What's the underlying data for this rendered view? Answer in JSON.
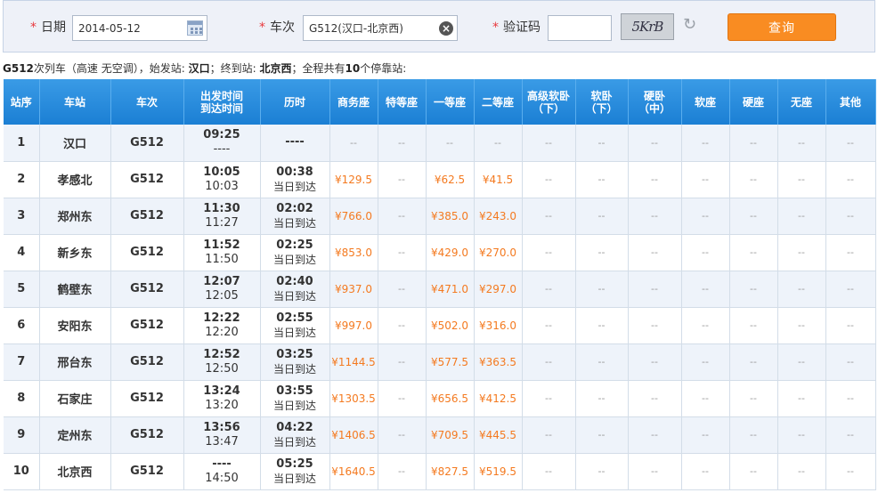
{
  "search": {
    "date_label": "日期",
    "date_value": "2014-05-12",
    "train_label": "车次",
    "train_value": "G512(汉口-北京西)",
    "captcha_label": "验证码",
    "captcha_value": "",
    "captcha_image_text": "5KrB",
    "query_button": "查询"
  },
  "summary": {
    "part1": "G512",
    "part2": "次列车（高速 无空调），始发站: ",
    "start": "汉口",
    "part3": "；终到站: ",
    "end": "北京西",
    "part4": "；全程共有",
    "count": "10",
    "part5": "个停靠站:"
  },
  "table": {
    "headers": {
      "seq": "站序",
      "station": "车站",
      "train": "车次",
      "time_top": "出发时间",
      "time_bottom": "到达时间",
      "duration": "历时",
      "business": "商务座",
      "special": "特等座",
      "first": "一等座",
      "second": "二等座",
      "soft_sleeper_top_1": "高级软卧",
      "soft_sleeper_top_2": "（下）",
      "soft_sleeper_1": "软卧",
      "soft_sleeper_2": "（下）",
      "hard_sleeper_1": "硬卧",
      "hard_sleeper_2": "（中）",
      "soft_seat": "软座",
      "hard_seat": "硬座",
      "no_seat": "无座",
      "other": "其他"
    },
    "rows": [
      {
        "seq": "1",
        "station": "汉口",
        "train": "G512",
        "dep": "09:25",
        "arr": "----",
        "dur": "----",
        "dur2": "",
        "business": "--",
        "first": "--",
        "second": "--"
      },
      {
        "seq": "2",
        "station": "孝感北",
        "train": "G512",
        "dep": "10:05",
        "arr": "10:03",
        "dur": "00:38",
        "dur2": "当日到达",
        "business": "¥129.5",
        "first": "¥62.5",
        "second": "¥41.5"
      },
      {
        "seq": "3",
        "station": "郑州东",
        "train": "G512",
        "dep": "11:30",
        "arr": "11:27",
        "dur": "02:02",
        "dur2": "当日到达",
        "business": "¥766.0",
        "first": "¥385.0",
        "second": "¥243.0"
      },
      {
        "seq": "4",
        "station": "新乡东",
        "train": "G512",
        "dep": "11:52",
        "arr": "11:50",
        "dur": "02:25",
        "dur2": "当日到达",
        "business": "¥853.0",
        "first": "¥429.0",
        "second": "¥270.0"
      },
      {
        "seq": "5",
        "station": "鹤壁东",
        "train": "G512",
        "dep": "12:07",
        "arr": "12:05",
        "dur": "02:40",
        "dur2": "当日到达",
        "business": "¥937.0",
        "first": "¥471.0",
        "second": "¥297.0"
      },
      {
        "seq": "6",
        "station": "安阳东",
        "train": "G512",
        "dep": "12:22",
        "arr": "12:20",
        "dur": "02:55",
        "dur2": "当日到达",
        "business": "¥997.0",
        "first": "¥502.0",
        "second": "¥316.0"
      },
      {
        "seq": "7",
        "station": "邢台东",
        "train": "G512",
        "dep": "12:52",
        "arr": "12:50",
        "dur": "03:25",
        "dur2": "当日到达",
        "business": "¥1144.5",
        "first": "¥577.5",
        "second": "¥363.5"
      },
      {
        "seq": "8",
        "station": "石家庄",
        "train": "G512",
        "dep": "13:24",
        "arr": "13:20",
        "dur": "03:55",
        "dur2": "当日到达",
        "business": "¥1303.5",
        "first": "¥656.5",
        "second": "¥412.5"
      },
      {
        "seq": "9",
        "station": "定州东",
        "train": "G512",
        "dep": "13:56",
        "arr": "13:47",
        "dur": "04:22",
        "dur2": "当日到达",
        "business": "¥1406.5",
        "first": "¥709.5",
        "second": "¥445.5"
      },
      {
        "seq": "10",
        "station": "北京西",
        "train": "G512",
        "dep": "----",
        "arr": "14:50",
        "dur": "05:25",
        "dur2": "当日到达",
        "business": "¥1640.5",
        "first": "¥827.5",
        "second": "¥519.5"
      }
    ],
    "empty_cell": "--"
  },
  "colors": {
    "accent": "#f98c22",
    "header_blue": "#1b7fd4",
    "price": "#f47a20",
    "required_star": "#e8383d"
  },
  "icons": {
    "date": "calendar-icon",
    "train_clear": "clear-icon",
    "captcha_refresh": "refresh-icon"
  }
}
